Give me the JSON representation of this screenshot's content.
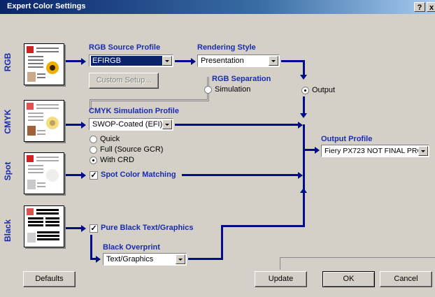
{
  "window": {
    "title": "Expert Color Settings",
    "help": "?",
    "close": "x"
  },
  "side_labels": {
    "rgb": "RGB",
    "cmyk": "CMYK",
    "spot": "Spot",
    "black": "Black"
  },
  "rgb_source": {
    "label": "RGB Source Profile",
    "value": "EFIRGB",
    "custom_setup": "Custom Setup..."
  },
  "rendering": {
    "label": "Rendering Style",
    "value": "Presentation"
  },
  "rgb_separation": {
    "label": "RGB Separation",
    "simulation": "Simulation",
    "output": "Output",
    "selected": "Output"
  },
  "cmyk_sim": {
    "label": "CMYK Simulation Profile",
    "value": "SWOP-Coated (EFI)",
    "quick": "Quick",
    "full": "Full (Source GCR)",
    "with_crd": "With CRD",
    "selected": "With CRD"
  },
  "spot": {
    "label": "Spot Color Matching",
    "checked": true
  },
  "black": {
    "pure_label": "Pure Black Text/Graphics",
    "pure_checked": true,
    "overprint_label": "Black Overprint",
    "overprint_value": "Text/Graphics"
  },
  "output_profile": {
    "label": "Output Profile",
    "value": "Fiery PX723 NOT FINAL PRO"
  },
  "buttons": {
    "defaults": "Defaults",
    "update": "Update",
    "ok": "OK",
    "cancel": "Cancel"
  },
  "colors": {
    "accent": "#1a2dab",
    "flow": "#000c8a",
    "titlebar": "#0a246a",
    "face": "#d4d0c8"
  }
}
